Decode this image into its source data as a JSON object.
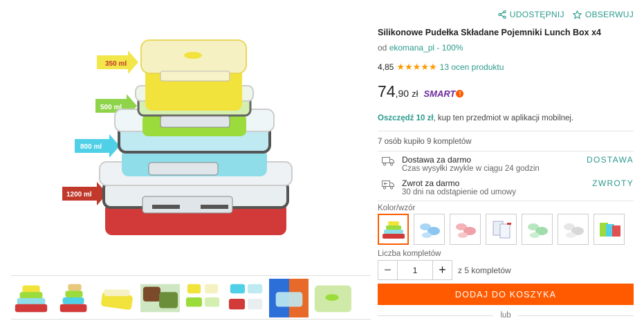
{
  "actions": {
    "share_label": "UDOSTĘPNIJ",
    "watch_label": "OBSERWUJ"
  },
  "product": {
    "title": "Silikonowe Pudełka Składane Pojemniki Lunch Box x4",
    "seller_prefix": "od",
    "seller_name": "ekomana_pl",
    "seller_score": "- 100%",
    "rating_value": "4,85",
    "rating_stars": "★★★★★",
    "rating_count": "13 ocen produktu",
    "price_int": "74",
    "price_frac": ",90",
    "price_currency": "zł",
    "smart_label": "SMART"
  },
  "promo": {
    "save_bold": "Oszczędź 10 zł",
    "save_rest": ", kup ten przedmiot w aplikacji mobilnej."
  },
  "bought_text": "7 osób kupiło 9 kompletów",
  "delivery": {
    "title": "Dostawa za darmo",
    "subtitle": "Czas wysyłki zwykle w ciągu 24 godzin",
    "link": "DOSTAWA"
  },
  "returns": {
    "title": "Zwrot za darmo",
    "subtitle": "30 dni na odstąpienie od umowy",
    "link": "ZWROTY"
  },
  "variant_label": "Kolor/wzór",
  "quantity": {
    "label": "Liczba kompletów",
    "value": "1",
    "minus": "−",
    "plus": "+",
    "max_text": "z 5 kompletów"
  },
  "cart_button": "DODAJ DO KOSZYKA",
  "or_text": "lub",
  "image_labels": [
    "350 ml",
    "500 ml",
    "800 ml",
    "1200 ml"
  ],
  "colors": {
    "accent": "#2b9a8c",
    "cta": "#ff5a00",
    "smart": "#6d2a9b",
    "stars": "#ff9900"
  }
}
